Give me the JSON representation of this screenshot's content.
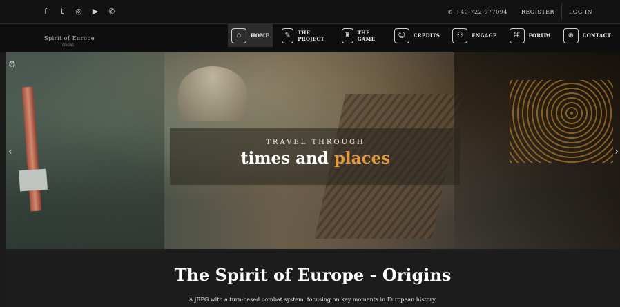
{
  "topbar": {
    "social": [
      {
        "icon": "facebook-icon",
        "glyph": "f"
      },
      {
        "icon": "twitter-icon",
        "glyph": "t"
      },
      {
        "icon": "instagram-icon",
        "glyph": "◎"
      },
      {
        "icon": "youtube-icon",
        "glyph": "▶"
      },
      {
        "icon": "whatsapp-icon",
        "glyph": "✆"
      }
    ],
    "phone": "+40-722-977094",
    "register": "REGISTER",
    "login": "LOG IN"
  },
  "logo": {
    "text": "Spirit of Europe",
    "subtitle": "ORIGINS"
  },
  "nav": {
    "items": [
      {
        "label": "HOME",
        "icon": "home-icon",
        "glyph": "⌂",
        "active": true
      },
      {
        "label": "THE PROJECT",
        "icon": "project-icon",
        "glyph": "✎",
        "active": false
      },
      {
        "label": "THE GAME",
        "icon": "game-icon",
        "glyph": "♜",
        "active": false
      },
      {
        "label": "CREDITS",
        "icon": "credits-icon",
        "glyph": "☺",
        "active": false
      },
      {
        "label": "ENGAGE",
        "icon": "engage-icon",
        "glyph": "⚇",
        "active": false
      },
      {
        "label": "FORUM",
        "icon": "forum-icon",
        "glyph": "⌘",
        "active": false
      },
      {
        "label": "CONTACT",
        "icon": "contact-icon",
        "glyph": "⊕",
        "active": false
      }
    ]
  },
  "hero": {
    "subtitle": "TRAVEL THROUGH",
    "title_main": "times and ",
    "title_accent": "places",
    "accent_color": "#e49a40"
  },
  "intro": {
    "title": "The Spirit of Europe - Origins",
    "description": "A jRPG with a turn-based combat system, focusing on key moments in European history."
  }
}
